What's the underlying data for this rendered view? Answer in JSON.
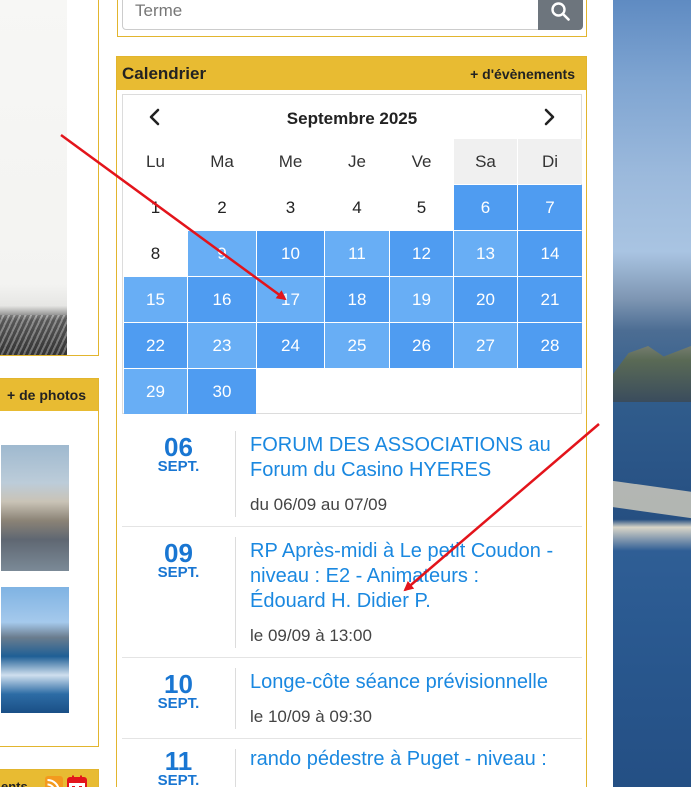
{
  "search": {
    "placeholder": "Terme"
  },
  "calendar": {
    "title": "Calendrier",
    "more_events": "+ d'évènements",
    "month_label": "Septembre 2025",
    "weekdays": [
      "Lu",
      "Ma",
      "Me",
      "Je",
      "Ve",
      "Sa",
      "Di"
    ],
    "weeks": [
      [
        {
          "d": "1",
          "event": false
        },
        {
          "d": "2",
          "event": false
        },
        {
          "d": "3",
          "event": false
        },
        {
          "d": "4",
          "event": false
        },
        {
          "d": "5",
          "event": false
        },
        {
          "d": "6",
          "event": true
        },
        {
          "d": "7",
          "event": true
        }
      ],
      [
        {
          "d": "8",
          "event": false
        },
        {
          "d": "9",
          "event": true
        },
        {
          "d": "10",
          "event": true
        },
        {
          "d": "11",
          "event": true
        },
        {
          "d": "12",
          "event": true
        },
        {
          "d": "13",
          "event": true
        },
        {
          "d": "14",
          "event": true
        }
      ],
      [
        {
          "d": "15",
          "event": true
        },
        {
          "d": "16",
          "event": true
        },
        {
          "d": "17",
          "event": true
        },
        {
          "d": "18",
          "event": true
        },
        {
          "d": "19",
          "event": true
        },
        {
          "d": "20",
          "event": true
        },
        {
          "d": "21",
          "event": true
        }
      ],
      [
        {
          "d": "22",
          "event": true
        },
        {
          "d": "23",
          "event": true
        },
        {
          "d": "24",
          "event": true
        },
        {
          "d": "25",
          "event": true
        },
        {
          "d": "26",
          "event": true
        },
        {
          "d": "27",
          "event": true
        },
        {
          "d": "28",
          "event": true
        }
      ],
      [
        {
          "d": "29",
          "event": true
        },
        {
          "d": "30",
          "event": true
        }
      ]
    ]
  },
  "events": [
    {
      "day": "06",
      "month": "SEPT.",
      "title_lines": [
        "FORUM DES ASSOCIATIONS au",
        "Forum du Casino HYERES"
      ],
      "when": "du 06/09 au 07/09"
    },
    {
      "day": "09",
      "month": "SEPT.",
      "title_lines": [
        "RP Après-midi à Le petit Coudon -",
        "niveau : E2 - Animateurs :",
        "Édouard H. Didier P."
      ],
      "when": "le 09/09 à 13:00"
    },
    {
      "day": "10",
      "month": "SEPT.",
      "title_lines": [
        "Longe-côte séance prévisionnelle"
      ],
      "when": "le 10/09 à 09:30"
    },
    {
      "day": "11",
      "month": "SEPT.",
      "title_lines": [
        "rando pédestre à Puget - niveau :"
      ],
      "when": ""
    }
  ],
  "photos": {
    "more_label": "+ de photos"
  },
  "news": {
    "label": "ents"
  },
  "colors": {
    "accent": "#e8bb32",
    "event_day": "#68aef5",
    "link": "#1a88e0",
    "annotation_arrow": "#e3141b"
  },
  "icons": [
    "search-icon",
    "chevron-left-icon",
    "chevron-right-icon",
    "rss-icon",
    "calendar-icon"
  ]
}
